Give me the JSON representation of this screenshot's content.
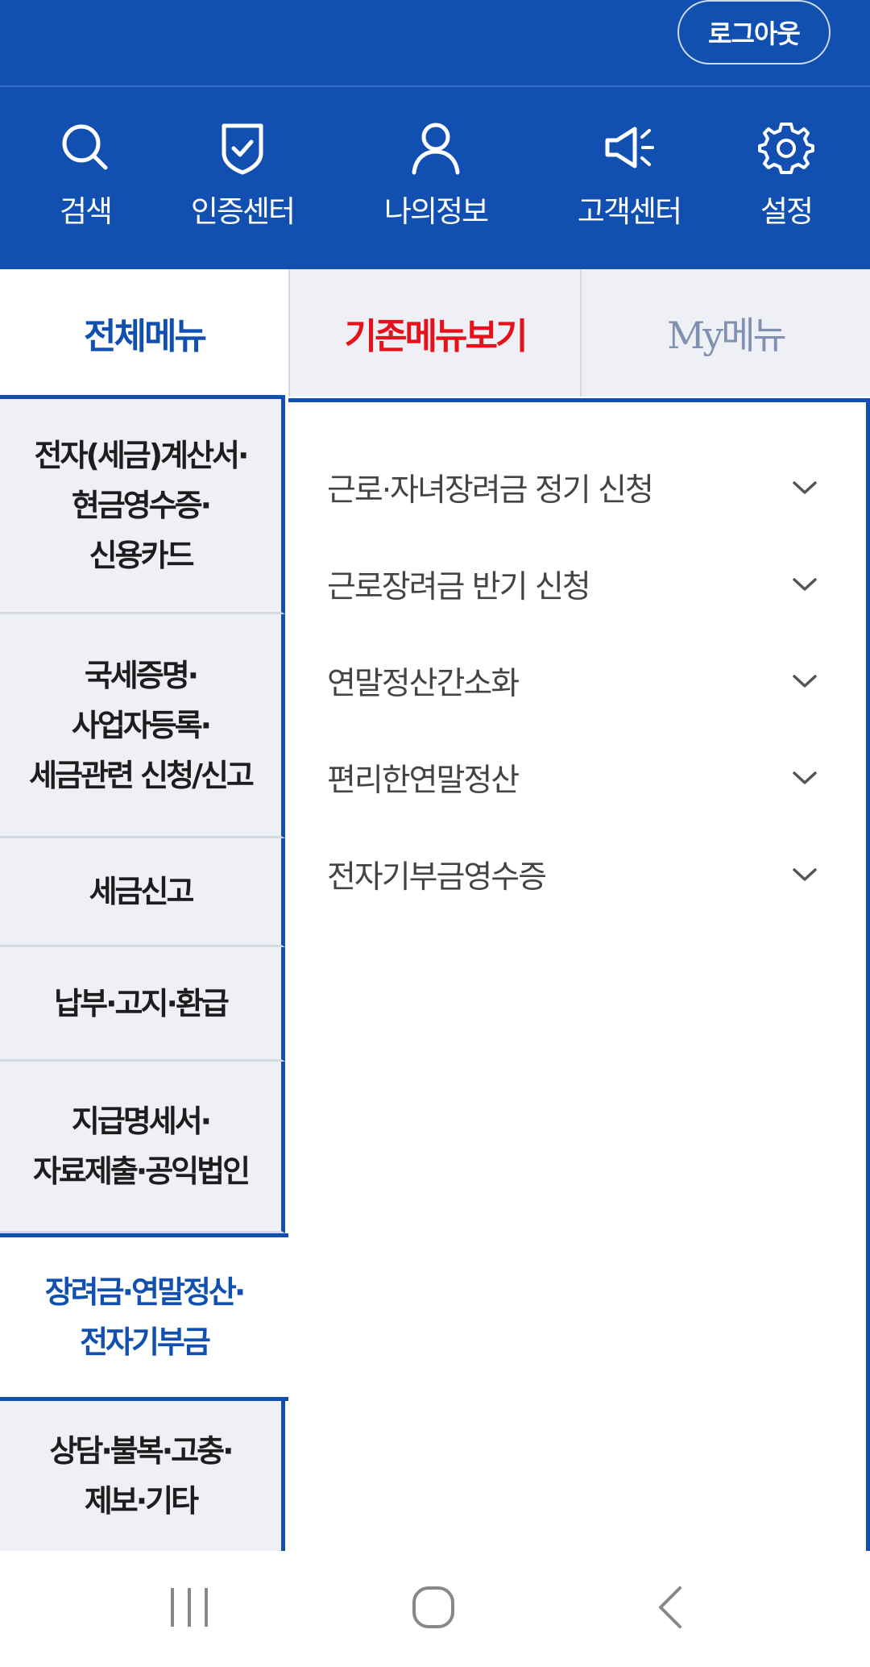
{
  "header": {
    "logout_label": "로그아웃"
  },
  "icon_bar": [
    {
      "label": "검색",
      "icon": "search-icon"
    },
    {
      "label": "인증센터",
      "icon": "shield-check-icon"
    },
    {
      "label": "나의정보",
      "icon": "person-icon"
    },
    {
      "label": "고객센터",
      "icon": "megaphone-icon"
    },
    {
      "label": "설정",
      "icon": "gear-icon"
    }
  ],
  "tabs": [
    {
      "label": "전체메뉴",
      "selected": true
    },
    {
      "label": "기존메뉴보기"
    },
    {
      "label": "My메뉴"
    }
  ],
  "categories": [
    {
      "label": "전자(세금)계산서·\n현금영수증·\n신용카드"
    },
    {
      "label": "국세증명·\n사업자등록·\n세금관련 신청/신고"
    },
    {
      "label": "세금신고"
    },
    {
      "label": "납부·고지·환급"
    },
    {
      "label": "지급명세서·\n자료제출·공익법인"
    },
    {
      "label": "장려금·연말정산·\n전자기부금",
      "selected": true
    },
    {
      "label": "상담·불복·고충·\n제보·기타"
    }
  ],
  "submenu": [
    {
      "label": "근로·자녀장려금 정기 신청"
    },
    {
      "label": "근로장려금 반기 신청"
    },
    {
      "label": "연말정산간소화"
    },
    {
      "label": "편리한연말정산"
    },
    {
      "label": "전자기부금영수증"
    }
  ],
  "colors": {
    "brand_blue": "#1150b0",
    "accent_red": "#e5121b"
  }
}
